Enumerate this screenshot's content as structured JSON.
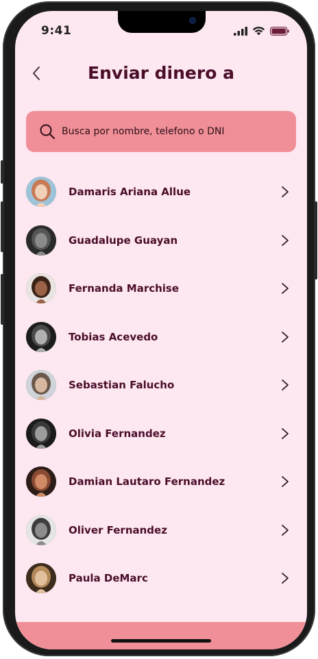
{
  "status_bar": {
    "time": "9:41",
    "icons": [
      "signal-icon",
      "wifi-icon",
      "battery-icon"
    ]
  },
  "header": {
    "back_icon": "chevron-left-icon",
    "title": "Enviar dinero a"
  },
  "search": {
    "icon": "search-icon",
    "placeholder": "Busca por nombre, telefono o DNI",
    "value": ""
  },
  "contacts": [
    {
      "name": "Damaris Ariana Allue",
      "avatar_colors": [
        "#9ec3d8",
        "#c77a54",
        "#f2d0b8"
      ]
    },
    {
      "name": "Guadalupe Guayan",
      "avatar_colors": [
        "#2a2a2a",
        "#555555",
        "#8a8a8a"
      ]
    },
    {
      "name": "Fernanda Marchise",
      "avatar_colors": [
        "#e8e4e2",
        "#3b2218",
        "#9a6246"
      ]
    },
    {
      "name": "Tobias Acevedo",
      "avatar_colors": [
        "#1c1c1c",
        "#4a4a4a",
        "#b0b0b0"
      ]
    },
    {
      "name": "Sebastian Falucho",
      "avatar_colors": [
        "#cfd4da",
        "#6b584d",
        "#d8b7a0"
      ]
    },
    {
      "name": "Olivia Fernandez",
      "avatar_colors": [
        "#1b1b1b",
        "#3a3a3a",
        "#9c9c9c"
      ]
    },
    {
      "name": "Damian Lautaro Fernandez",
      "avatar_colors": [
        "#2c1d18",
        "#8a4b34",
        "#d08a65"
      ]
    },
    {
      "name": "Oliver Fernandez",
      "avatar_colors": [
        "#e5e5e5",
        "#3d3d3d",
        "#8c8c8c"
      ]
    },
    {
      "name": "Paula DeMarc",
      "avatar_colors": [
        "#3b2c1c",
        "#b48a5a",
        "#e2c09e"
      ]
    }
  ],
  "row_action_icon": "chevron-right-icon",
  "colors": {
    "background": "#fde7f0",
    "accent": "#f08f98",
    "text": "#4a0d2a"
  }
}
